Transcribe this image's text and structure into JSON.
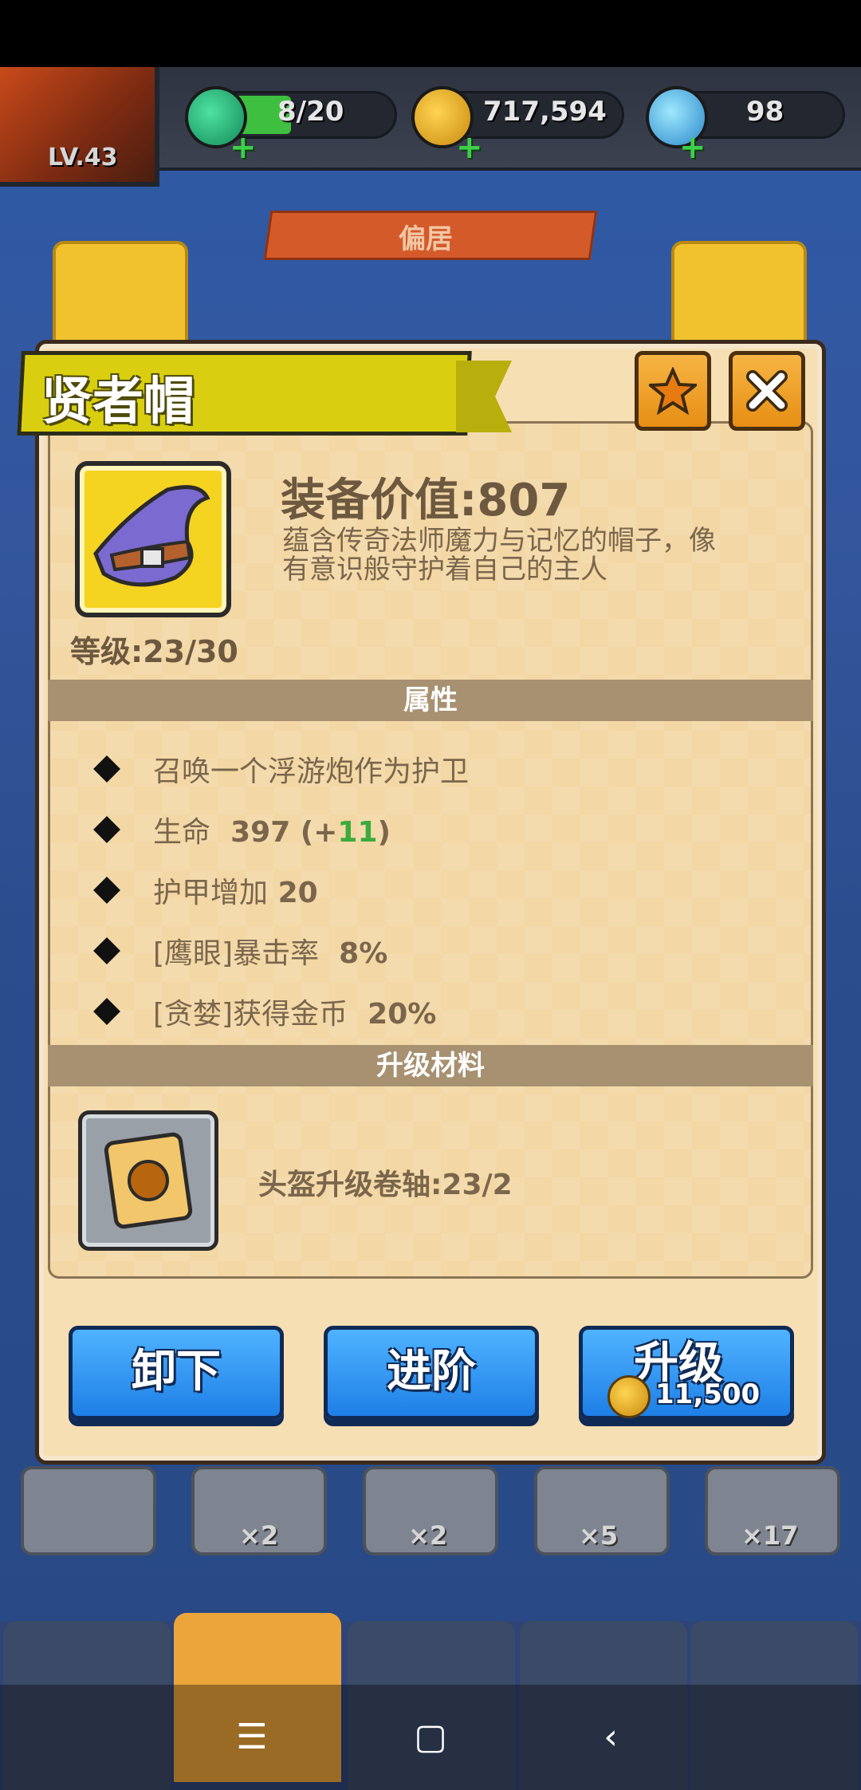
{
  "header": {
    "level": "LV.43",
    "energy": "8/20",
    "coins": "717,594",
    "gems": "98",
    "sub_title": "偏居"
  },
  "modal": {
    "title": "贤者帽",
    "value_label": "装备价值:807",
    "description": "蕴含传奇法师魔力与记忆的帽子，像有意识般守护着自己的主人",
    "level": "等级:23/30",
    "attributes_title": "属性",
    "attributes": [
      {
        "prefix": "召唤一个浮游炮作为护卫",
        "value": "",
        "bonus": ""
      },
      {
        "prefix": "生命",
        "value": "397",
        "bonus": "11"
      },
      {
        "prefix": "护甲增加",
        "value": "20",
        "bonus": ""
      },
      {
        "prefix": "[鹰眼]暴击率",
        "value": "8%",
        "bonus": ""
      },
      {
        "prefix": "[贪婪]获得金币",
        "value": "20%",
        "bonus": ""
      }
    ],
    "materials_title": "升级材料",
    "material_label": "头盔升级卷轴:23/2",
    "buttons": {
      "unequip": "卸下",
      "advance": "进阶",
      "upgrade": "升级",
      "upgrade_cost": "11,500"
    }
  },
  "inventory_counts": [
    "×2",
    "×2",
    "×5",
    "×17"
  ],
  "colors": {
    "title_banner": "#d9cf10",
    "button_blue": "#1e7fe6",
    "modal_bg": "#f7dfb4",
    "section_bar": "#a79171",
    "bonus_green": "#3cab3c"
  }
}
